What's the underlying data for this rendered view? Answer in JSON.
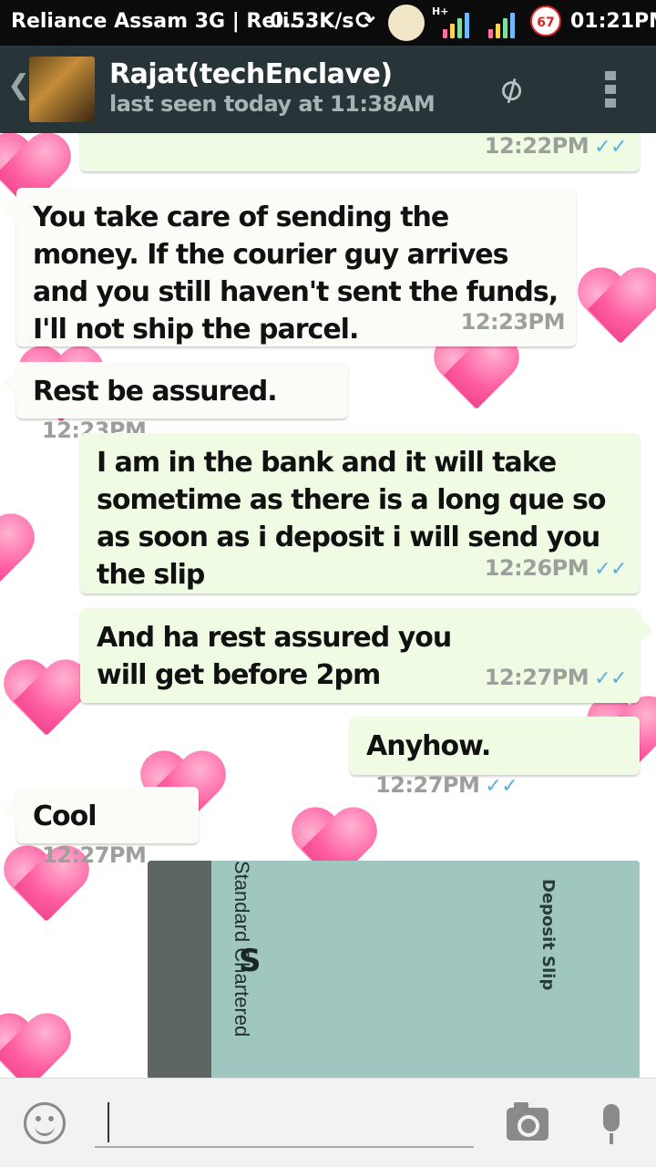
{
  "status_bar": {
    "carrier": "Reliance Assam 3G | Reli...",
    "speed": "0.53K/s",
    "network_type": "H+",
    "notification_count": "67",
    "time": "01:21PM"
  },
  "header": {
    "contact_name": "Rajat(techEnclave)",
    "last_seen": "last seen today at 11:38AM",
    "back_icon": "chevron-left-icon",
    "attach_icon": "paperclip-icon",
    "menu_icon": "overflow-menu-icon"
  },
  "messages": [
    {
      "direction": "out",
      "text": "",
      "time": "12:22PM",
      "ticks": "✓✓"
    },
    {
      "direction": "in",
      "text": "You take care of sending the money. If the courier guy arrives and you still haven't sent the funds, I'll not ship the parcel.",
      "time": "12:23PM"
    },
    {
      "direction": "in",
      "text": "Rest be assured.",
      "time": "12:23PM"
    },
    {
      "direction": "out",
      "text": "I am in the bank and it will take sometime as there is a long que so as soon as i deposit i will send you the slip",
      "time": "12:26PM",
      "ticks": "✓✓"
    },
    {
      "direction": "out",
      "text": "And ha rest assured you will get before 2pm",
      "time": "12:27PM",
      "ticks": "✓✓"
    },
    {
      "direction": "out",
      "text": "Anyhow.",
      "time": "12:27PM",
      "ticks": "✓✓"
    },
    {
      "direction": "in",
      "text": "Cool",
      "time": "12:27PM"
    }
  ],
  "photo_message": {
    "bank_name": "Standard Chartered",
    "slip_title": "Deposit Slip"
  },
  "input_bar": {
    "placeholder": "",
    "emoji_icon": "smiley-icon",
    "camera_icon": "camera-icon",
    "mic_icon": "microphone-icon"
  },
  "colors": {
    "header_bg": "#283538",
    "incoming_bubble": "#fbfbf7",
    "outgoing_bubble": "#f0fbe3",
    "tick_blue": "#5aaee8",
    "heart_pink": "#ff5fa2"
  }
}
